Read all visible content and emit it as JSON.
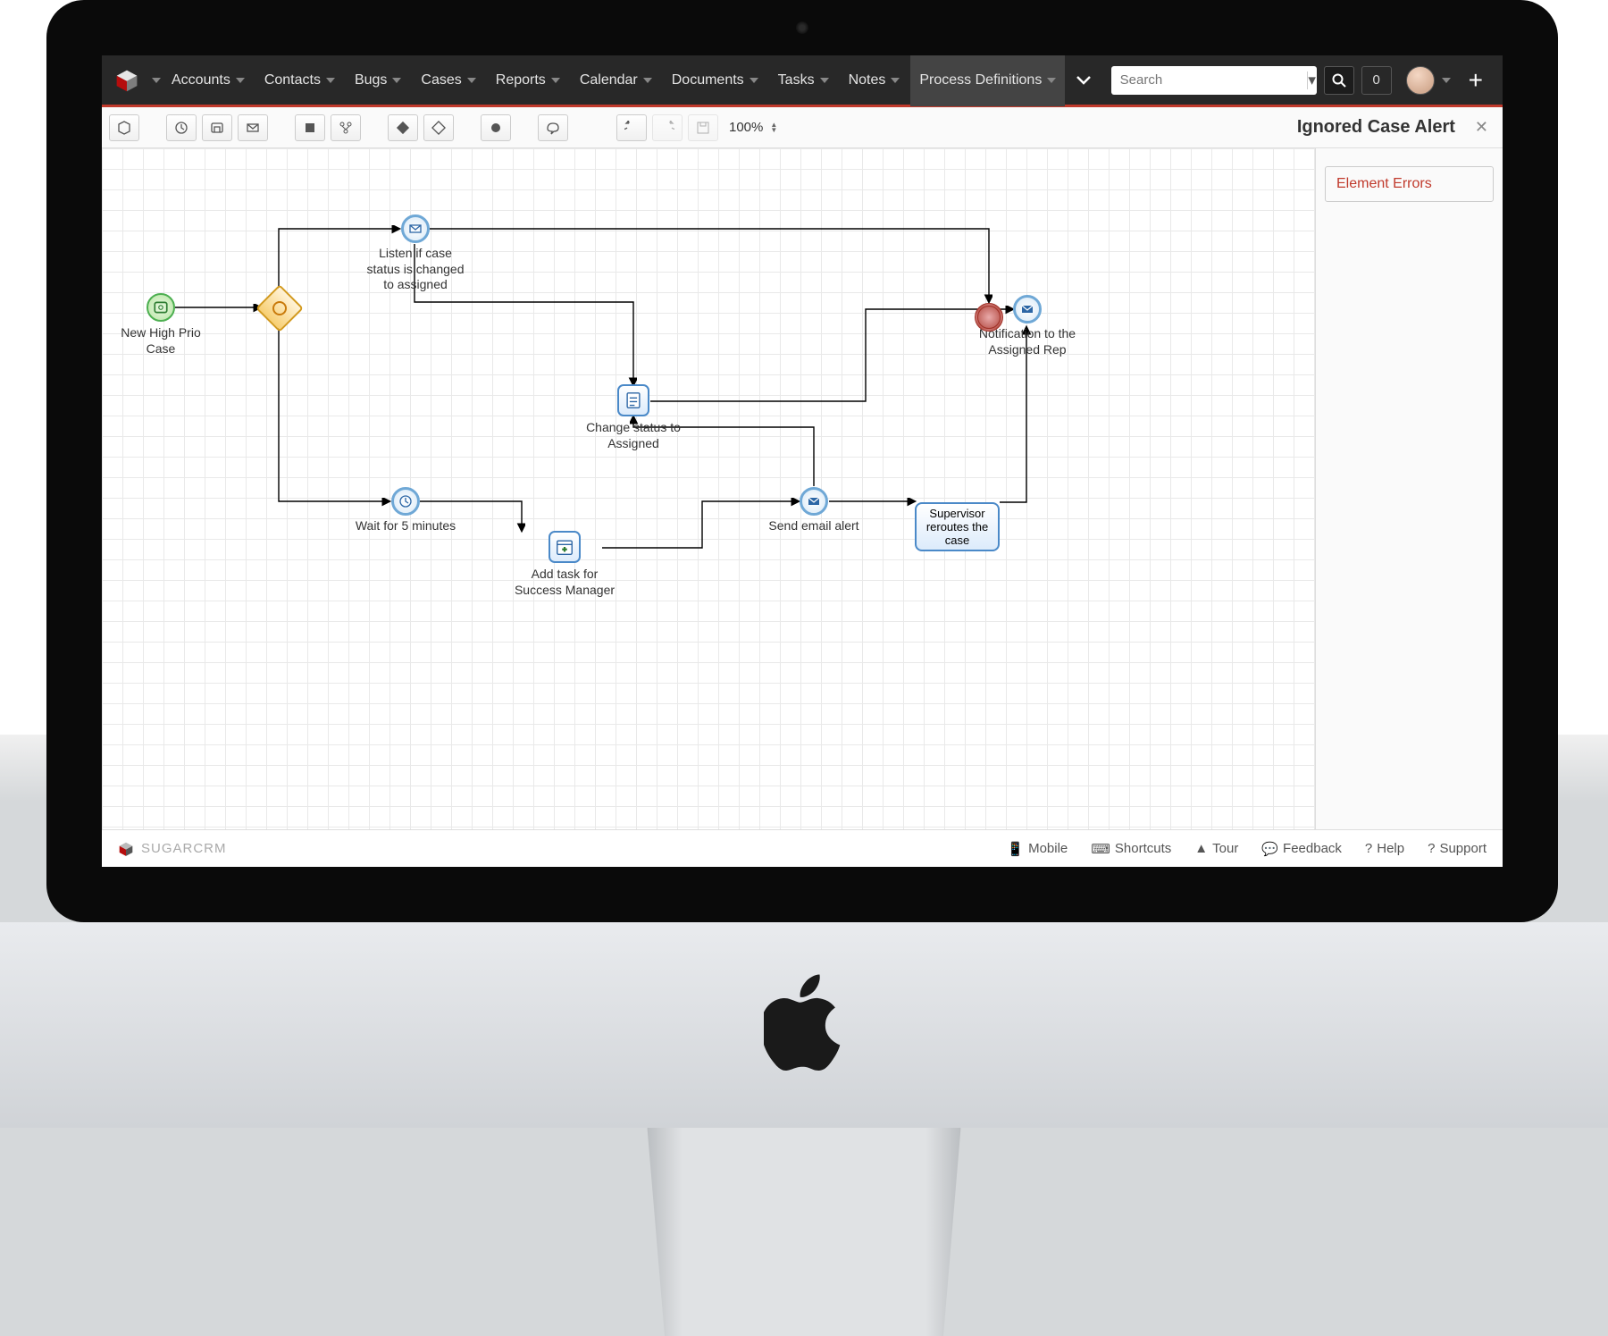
{
  "nav": {
    "items": [
      "Accounts",
      "Contacts",
      "Bugs",
      "Cases",
      "Reports",
      "Calendar",
      "Documents",
      "Tasks",
      "Notes",
      "Process Definitions"
    ],
    "active_index": 9,
    "search_placeholder": "Search",
    "notification_count": "0"
  },
  "toolbar": {
    "zoom": "100%",
    "title": "Ignored Case Alert"
  },
  "sidepanel": {
    "errors_label": "Element Errors"
  },
  "footer": {
    "brand_main": "SUGAR",
    "brand_sub": "CRM",
    "links": [
      "Mobile",
      "Shortcuts",
      "Tour",
      "Feedback",
      "Help",
      "Support"
    ]
  },
  "diagram": {
    "start_label": "New High Prio Case",
    "listen_label": "Listen if case status is changed to assigned",
    "wait_label": "Wait for 5 minutes",
    "change_label": "Change status to Assigned",
    "addtask_label": "Add task for Success Manager",
    "sendemail_label": "Send email alert",
    "supervisor_label": "Supervisor reroutes the case",
    "notify_label": "Notification to the Assigned Rep"
  }
}
